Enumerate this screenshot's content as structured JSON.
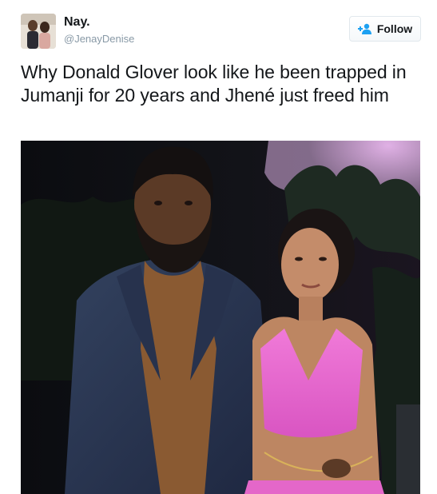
{
  "tweet": {
    "display_name": "Nay.",
    "handle": "@JenayDenise",
    "text": "Why Donald Glover look like he been trapped in Jumanji for 20 years and Jhené just freed him"
  },
  "follow_button": {
    "label": "Follow",
    "icon": "add-user-icon"
  },
  "colors": {
    "accent": "#1da1f2",
    "text": "#14171a",
    "muted": "#8899a6",
    "button_border": "#e1e8ed"
  }
}
